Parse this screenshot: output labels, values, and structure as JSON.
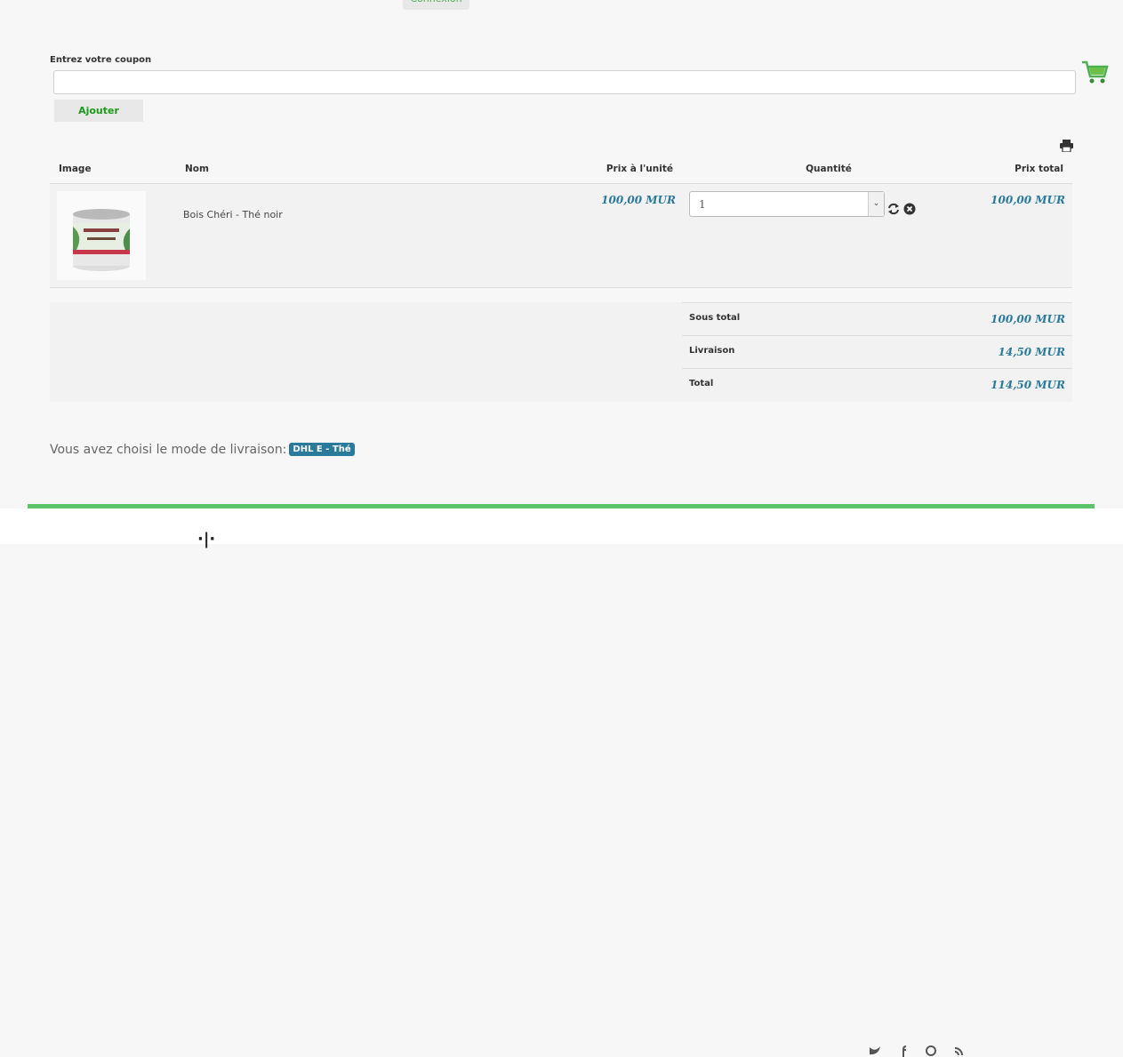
{
  "header": {
    "login_label": "Connexion"
  },
  "coupon": {
    "label": "Entrez votre coupon",
    "value": "",
    "placeholder": "",
    "add_label": "Ajouter"
  },
  "icons": {
    "cart": "cart-icon",
    "print": "printer-icon",
    "refresh": "refresh-icon",
    "remove": "remove-circle-icon"
  },
  "table": {
    "headers": {
      "image": "Image",
      "name": "Nom",
      "unit_price": "Prix à l'unité",
      "quantity": "Quantité",
      "total_price": "Prix total"
    },
    "rows": [
      {
        "image_alt": "Bois Chéri tea tin",
        "name": "Bois Chéri - Thé noir",
        "unit_price": "100,00 MUR",
        "quantity": "1",
        "total_price": "100,00 MUR"
      }
    ]
  },
  "summary": {
    "subtotal_label": "Sous total",
    "subtotal_value": "100,00 MUR",
    "shipping_label": "Livraison",
    "shipping_value": "14,50 MUR",
    "total_label": "Total",
    "total_value": "114,50 MUR"
  },
  "shipping_mode": {
    "text": "Vous avez choisi le mode de livraison:",
    "badge": "DHL E - Thé"
  },
  "colors": {
    "accent_green": "#5cc46a",
    "price_blue": "#2a7a9b",
    "button_text_green": "#1a9a1a"
  }
}
